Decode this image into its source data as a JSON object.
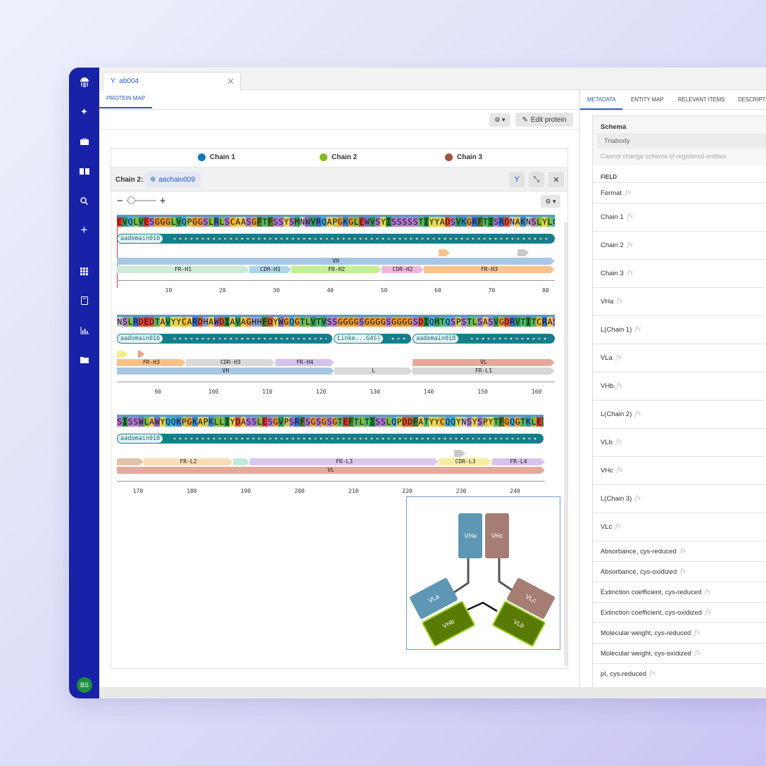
{
  "tab": {
    "title": "ab004"
  },
  "subtabs": {
    "protein_map": "PROTEIN MAP"
  },
  "toolbar": {
    "edit_label": "Edit protein"
  },
  "legend": [
    {
      "label": "Chain 1",
      "color": "#1177b8"
    },
    {
      "label": "Chain 2",
      "color": "#86bb19"
    },
    {
      "label": "Chain 3",
      "color": "#a0533e"
    }
  ],
  "chain": {
    "label": "Chain 2:",
    "name": "aachain009"
  },
  "rows": [
    {
      "seq": "EVQLVESGGGLVQPGGSLRLSCAASGFTFSSYSMNWVRQAPGKGLEWVSYISSSSSTIYYADSVKGRFTISRDNAKNSLYLQM",
      "domains": [
        {
          "label": "aadomain016"
        }
      ],
      "features": [
        {
          "label": "VH"
        },
        {
          "label": "FR-H1"
        },
        {
          "label": "CDR-H1"
        },
        {
          "label": "FR-H2"
        },
        {
          "label": "CDR-H2"
        },
        {
          "label": "FR-H3"
        }
      ],
      "ticks": [
        "10",
        "20",
        "30",
        "40",
        "50",
        "60",
        "70",
        "80"
      ]
    },
    {
      "seq": "NSLRDEDTAVYYCARDHAWDIAVAGHHFDYWGQGTLVTVSSGGGGSGGGGSGGGGSDIQMTQSPSTLSASVGDRVTITCRASQ",
      "domains": [
        {
          "label": "aadomain016"
        },
        {
          "label": "Linke...G4S)"
        },
        {
          "label": "aadomain018"
        }
      ],
      "features": [
        {
          "label": "FR-H3"
        },
        {
          "label": "CDR-H3"
        },
        {
          "label": "FR-H4"
        },
        {
          "label": "VL"
        },
        {
          "label": "VH"
        },
        {
          "label": "L"
        },
        {
          "label": "FR-L1"
        }
      ],
      "ticks": [
        "90",
        "100",
        "110",
        "120",
        "130",
        "140",
        "150",
        "160"
      ]
    },
    {
      "seq": "SISSWLAWYQQKPGKAPKLLIYDASSLESGVPSRFSGSGSGTEFTLTISSLQPDDFATYYCQQYNSYSPYTFGQGTKLEIK",
      "domains": [
        {
          "label": "aadomain018"
        }
      ],
      "features": [
        {
          "label": ""
        },
        {
          "label": "FR-L2"
        },
        {
          "label": ""
        },
        {
          "label": "FR-L3"
        },
        {
          "label": "CDR-L3"
        },
        {
          "label": "FR-L4"
        },
        {
          "label": "VL"
        }
      ],
      "ticks": [
        "170",
        "180",
        "190",
        "200",
        "210",
        "220",
        "230",
        "240"
      ]
    }
  ],
  "diagram": {
    "boxes": [
      {
        "label": "VHa",
        "color": "#5e97b4"
      },
      {
        "label": "VHc",
        "color": "#a57d72"
      },
      {
        "label": "VLa",
        "color": "#5e97b4"
      },
      {
        "label": "VLc",
        "color": "#a57d72"
      },
      {
        "label": "VHb",
        "color": "#5a7a06"
      },
      {
        "label": "VLb",
        "color": "#5a7a06"
      }
    ]
  },
  "right_tabs": [
    "METADATA",
    "ENTITY MAP",
    "RELEVANT ITEMS",
    "DESCRIPTI"
  ],
  "schema": {
    "title": "Schema",
    "value": "Triabody",
    "note": "Cannot change schema of registered entities"
  },
  "field_header": "FIELD",
  "fields": [
    "Format",
    "Chain 1",
    "Chain 2",
    "Chain 3",
    "VHa",
    "L(Chain 1)",
    "VLa",
    "VHb",
    "L(Chain 2)",
    "VLb",
    "VHc",
    "L(Chain 3)",
    "VLc",
    "Absorbance, cys-reduced",
    "Absorbance, cys-oxidized",
    "Extinction coefficient, cys-reduced",
    "Extinction coefficient, cys-oxidized",
    "Molecular weight, cys-reduced",
    "Molecular weight, cys-oxidized",
    "pI, cys-reduced"
  ],
  "user": {
    "initials": "BS"
  },
  "aa_colors": {
    "A": "#f0c94a",
    "R": "#3d6fd6",
    "N": "#c9c9c9",
    "D": "#e8512f",
    "C": "#f0b21e",
    "Q": "#3fb1e0",
    "E": "#e03a2f",
    "G": "#ed9b32",
    "H": "#8fa9d8",
    "I": "#1b8a3a",
    "L": "#7fbf3c",
    "K": "#3b8fd0",
    "M": "#3e9e57",
    "F": "#4d7a2a",
    "P": "#c9c955",
    "S": "#b27bd6",
    "T": "#58b86a",
    "W": "#8b6dbe",
    "Y": "#e6d84a",
    "V": "#2e9b5a"
  }
}
